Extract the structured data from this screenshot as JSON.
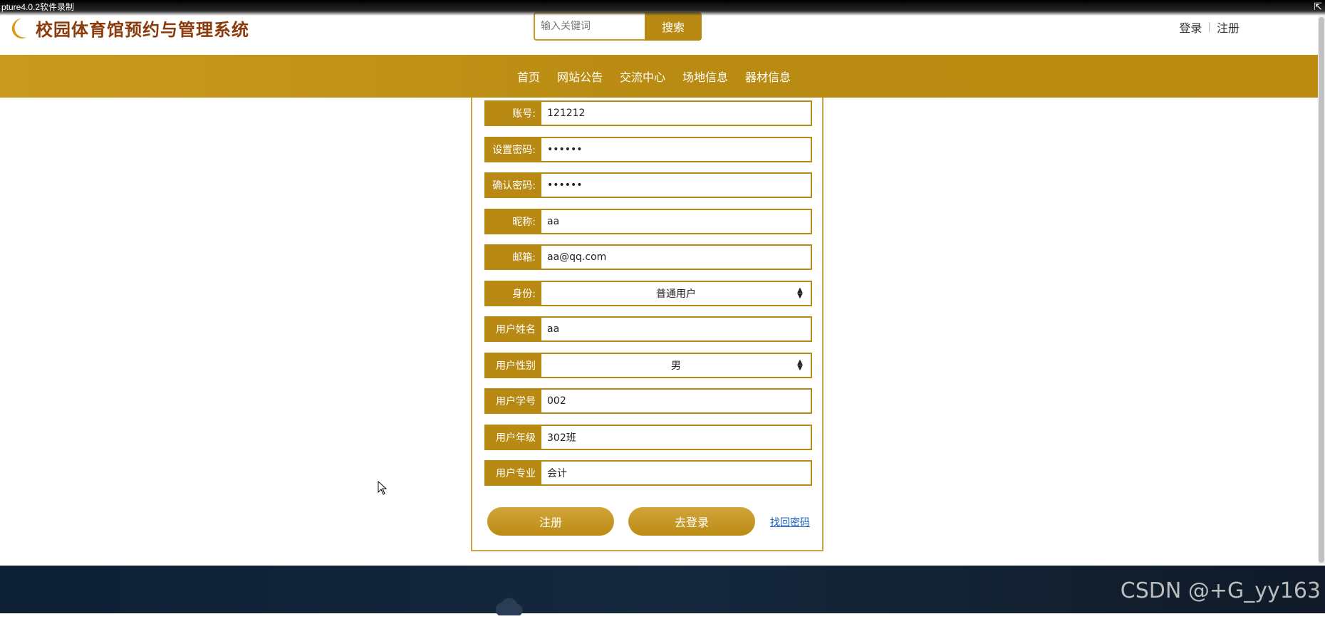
{
  "recorder": {
    "caption": "pture4.0.2软件录制"
  },
  "header": {
    "site_title": "校园体育馆预约与管理系统",
    "search_placeholder": "输入关键词",
    "search_button": "搜索",
    "login_link": "登录",
    "register_link": "注册"
  },
  "nav": [
    "首页",
    "网站公告",
    "交流中心",
    "场地信息",
    "器材信息"
  ],
  "form": {
    "fields": [
      {
        "label": "账号:",
        "value": "121212",
        "type": "text"
      },
      {
        "label": "设置密码:",
        "value": "••••••",
        "type": "password"
      },
      {
        "label": "确认密码:",
        "value": "••••••",
        "type": "password"
      },
      {
        "label": "昵称:",
        "value": "aa",
        "type": "text"
      },
      {
        "label": "邮箱:",
        "value": "aa@qq.com",
        "type": "text"
      },
      {
        "label": "身份:",
        "value": "普通用户",
        "type": "select"
      },
      {
        "label": "用户姓名",
        "value": "aa",
        "type": "text"
      },
      {
        "label": "用户性别",
        "value": "男",
        "type": "select"
      },
      {
        "label": "用户学号",
        "value": "002",
        "type": "text"
      },
      {
        "label": "用户年级",
        "value": "302班",
        "type": "text"
      },
      {
        "label": "用户专业",
        "value": "会计",
        "type": "text"
      }
    ],
    "register_button": "注册",
    "go_login_button": "去登录",
    "forgot_link": "找回密码"
  },
  "watermark": "CSDN @+G_yy163",
  "colors": {
    "accent": "#b88a14",
    "title": "#8b3a0b",
    "footer": "#0d1f33",
    "link": "#1a5ec2"
  }
}
